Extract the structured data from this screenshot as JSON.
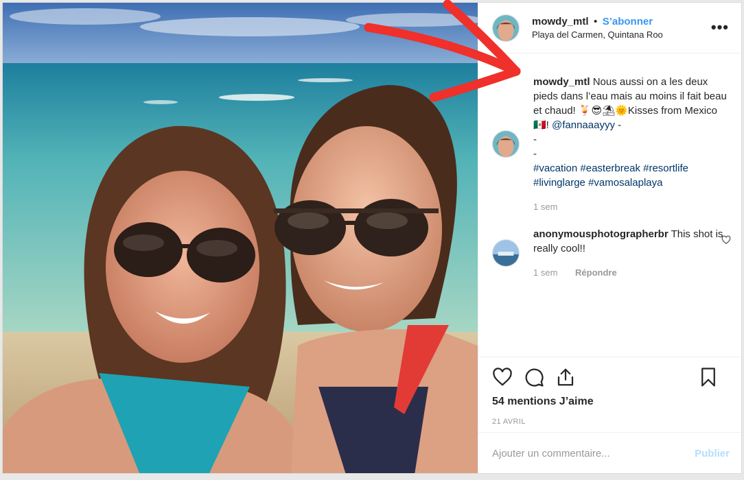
{
  "post": {
    "username": "mowdy_mtl",
    "dot": "•",
    "follow_label": "S’abonner",
    "location": "Playa del Carmen, Quintana Roo",
    "more_label": "•••"
  },
  "caption": {
    "username": "mowdy_mtl",
    "text_line": "Nous aussi on a les deux pieds dans l’eau mais au moins il fait beau et chaud! 🍹😎⛱🌞Kisses from Mexico 🇲🇽! ",
    "mention": "@fannaaayyy",
    "after_mention": " -",
    "dash1": "-",
    "dash2": "-",
    "hashtags": [
      "#vacation",
      "#easterbreak",
      "#resortlife",
      "#livinglarge",
      "#vamosalaplaya"
    ],
    "time": "1 sem"
  },
  "comment": {
    "username": "anonymousphotographerbr",
    "text": " This shot is really cool!!",
    "time": "1 sem",
    "reply_label": "Répondre"
  },
  "actions": {
    "likes": "54 mentions J’aime",
    "date": "21 AVRIL"
  },
  "composer": {
    "placeholder": "Ajouter un commentaire...",
    "publish_label": "Publier"
  },
  "colors": {
    "link": "#003569",
    "follow": "#3897f0",
    "publish_disabled": "#b2dffc",
    "annotation_arrow": "#f0302a"
  }
}
